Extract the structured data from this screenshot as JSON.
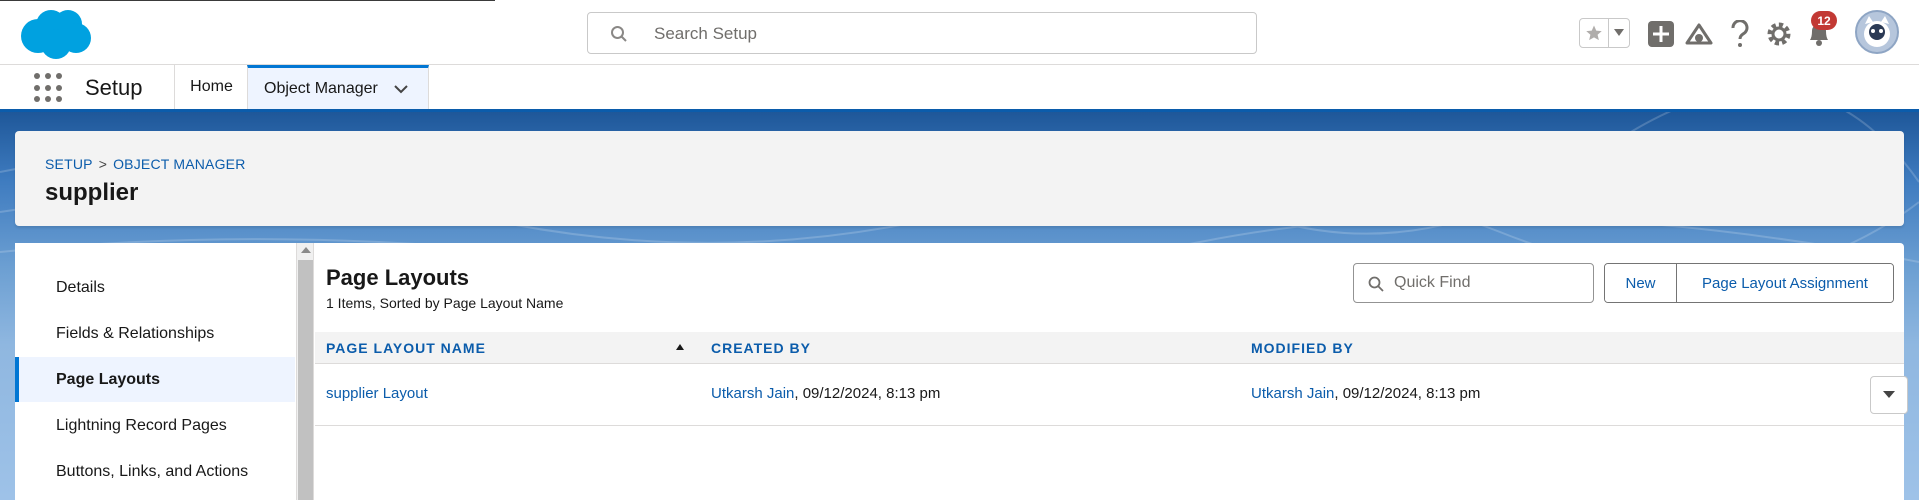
{
  "header": {
    "search_placeholder": "Search Setup",
    "notification_count": "12",
    "icons": [
      "cloud-logo",
      "search-icon",
      "star-icon",
      "chevron-down-icon",
      "add-icon",
      "trailhead-icon",
      "help-icon",
      "gear-icon",
      "bell-icon",
      "avatar"
    ]
  },
  "nav": {
    "app_name": "Setup",
    "tabs": [
      {
        "label": "Home",
        "active": false
      },
      {
        "label": "Object Manager",
        "active": true
      }
    ]
  },
  "object_header": {
    "breadcrumb": [
      "SETUP",
      "OBJECT MANAGER"
    ],
    "breadcrumb_separator": ">",
    "title": "supplier"
  },
  "sidebar": {
    "items": [
      {
        "label": "Details",
        "active": false
      },
      {
        "label": "Fields & Relationships",
        "active": false
      },
      {
        "label": "Page Layouts",
        "active": true
      },
      {
        "label": "Lightning Record Pages",
        "active": false
      },
      {
        "label": "Buttons, Links, and Actions",
        "active": false
      }
    ]
  },
  "main": {
    "title": "Page Layouts",
    "subtitle": "1 Items, Sorted by Page Layout Name",
    "quick_find_placeholder": "Quick Find",
    "buttons": {
      "new": "New",
      "assignment": "Page Layout Assignment"
    },
    "table": {
      "columns": [
        "PAGE LAYOUT NAME",
        "CREATED BY",
        "MODIFIED BY"
      ],
      "sorted_column": "PAGE LAYOUT NAME",
      "sort_direction": "ascending",
      "rows": [
        {
          "name": "supplier Layout",
          "created_by_user": "Utkarsh Jain",
          "created_by_date": ", 09/12/2024, 8:13 pm",
          "modified_by_user": "Utkarsh Jain",
          "modified_by_date": ", 09/12/2024, 8:13 pm"
        }
      ]
    }
  },
  "colors": {
    "brand_blue": "#0176d3",
    "link_blue": "#0b5cab",
    "badge_red": "#c23934",
    "cloud_blue": "#00a1e0"
  }
}
